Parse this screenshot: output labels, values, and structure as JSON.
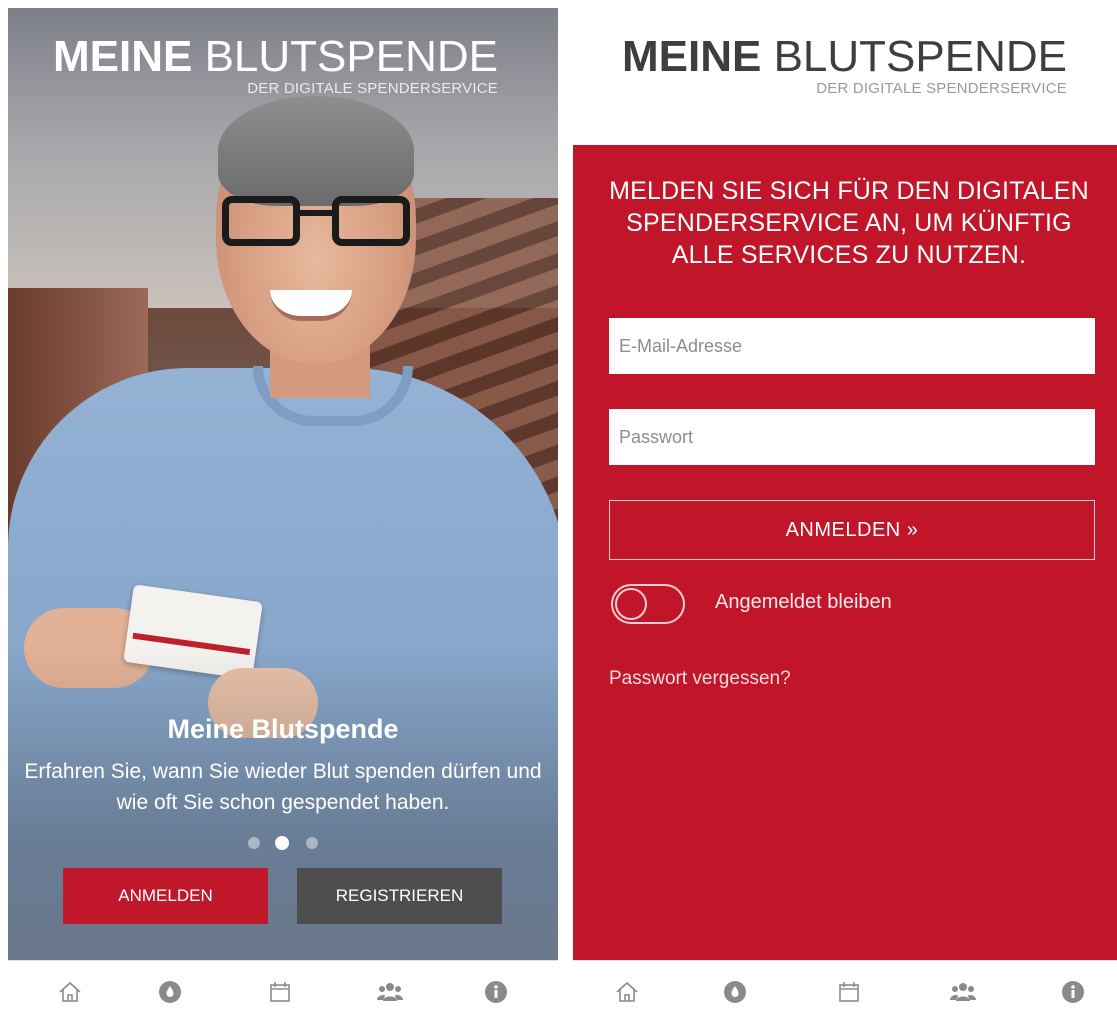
{
  "logo": {
    "main_bold": "MEINE",
    "main_light": "BLUTSPENDE",
    "subtitle": "DER DIGITALE SPENDERSERVICE"
  },
  "left": {
    "slide": {
      "title": "Meine Blutspende",
      "text_line1": "Erfahren Sie, wann Sie wieder Blut spenden dürfen und",
      "text_line2": "wie oft Sie schon gespendet haben."
    },
    "carousel": {
      "count": 3,
      "active_index": 1
    },
    "buttons": {
      "login_label": "ANMELDEN",
      "register_label": "REGISTRIEREN"
    }
  },
  "right": {
    "headline_line1": "MELDEN SIE SICH FÜR DEN DIGITALEN",
    "headline_line2": "SPENDERSERVICE AN, UM KÜNFTIG",
    "headline_line3": "ALLE SERVICES ZU NUTZEN.",
    "email": {
      "placeholder": "E-Mail-Adresse",
      "value": ""
    },
    "password": {
      "placeholder": "Passwort",
      "value": ""
    },
    "login_label": "ANMELDEN »",
    "stay_logged_in": {
      "label": "Angemeldet bleiben",
      "checked": false
    },
    "forgot_password": "Passwort vergessen?"
  },
  "bottom_nav": {
    "items": [
      {
        "icon": "home-icon"
      },
      {
        "icon": "blood-drop-icon"
      },
      {
        "icon": "calendar-icon"
      },
      {
        "icon": "users-icon"
      },
      {
        "icon": "info-icon"
      }
    ]
  },
  "colors": {
    "brand_red": "#c1152a",
    "dark_gray_button": "#4e4e4f",
    "nav_icon": "#8a8a8a"
  }
}
